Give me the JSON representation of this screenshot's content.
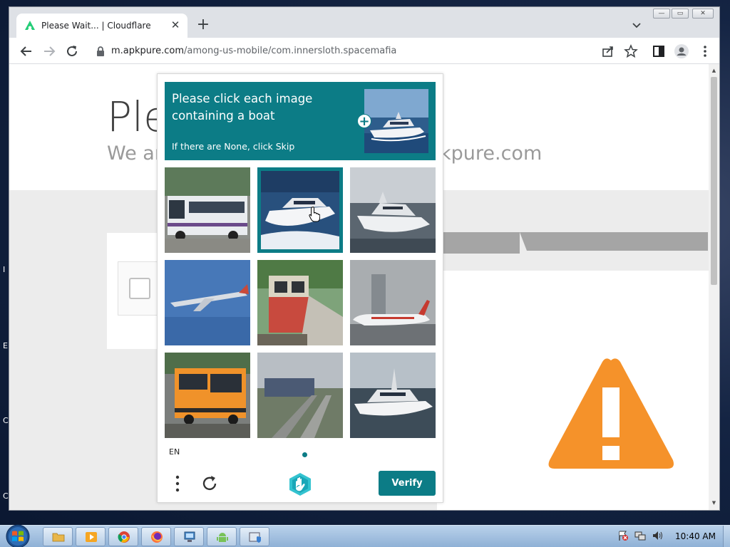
{
  "browser": {
    "tab_title": "Please Wait... | Cloudflare",
    "tab_close": "✕",
    "new_tab": "+",
    "url_host": "m.apkpure.com",
    "url_path": "/among-us-mobile/com.innersloth.spacemafia"
  },
  "window_controls": {
    "minimize": "—",
    "maximize": "▭",
    "close": "✕"
  },
  "page": {
    "heading": "Ple",
    "subheading_left": "We ar",
    "subheading_right": "kpure.com"
  },
  "captcha": {
    "prompt_title": "Please click each image containing a boat",
    "prompt_sub": "If there are None, click Skip",
    "plus_label": "+",
    "language": "EN",
    "verify_label": "Verify",
    "accent_color": "#0c7c86",
    "tiles": [
      {
        "subject": "bus",
        "selected": false
      },
      {
        "subject": "boat",
        "selected": true
      },
      {
        "subject": "boat",
        "selected": false
      },
      {
        "subject": "airplane",
        "selected": false
      },
      {
        "subject": "train",
        "selected": false
      },
      {
        "subject": "airplane",
        "selected": false
      },
      {
        "subject": "bus",
        "selected": false
      },
      {
        "subject": "train",
        "selected": false
      },
      {
        "subject": "boat",
        "selected": false
      }
    ]
  },
  "taskbar": {
    "clock": "10:40 AM",
    "apps": [
      "explorer",
      "media-player",
      "chrome",
      "firefox",
      "network",
      "android",
      "shield"
    ]
  },
  "desktop_chars": [
    "I",
    "E",
    "C",
    "C"
  ],
  "colors": {
    "warning": "#f5922a",
    "teal": "#0c7c86"
  }
}
